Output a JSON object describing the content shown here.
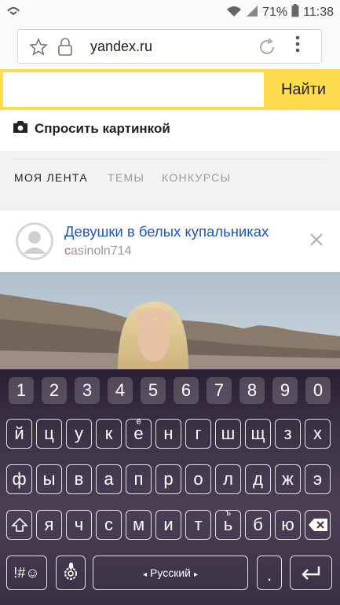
{
  "status_bar": {
    "battery_text": "71%",
    "time": "11:38",
    "icons": [
      "cloud-sync-icon",
      "wifi-icon",
      "signal-icon",
      "battery-icon"
    ]
  },
  "browser": {
    "url": "yandex.ru",
    "icons": [
      "star-icon",
      "lock-icon",
      "reload-icon",
      "more-vert-icon"
    ]
  },
  "search": {
    "value": "",
    "button_label": "Найти",
    "image_search_label": "Спросить картинкой",
    "accent_color": "#ffdb4d"
  },
  "feed_tabs": [
    "МОЯ ЛЕНТА",
    "ТЕМЫ",
    "КОНКУРСЫ"
  ],
  "post": {
    "title": "Девушки в белых купальниках",
    "author_first": "c",
    "author_rest": "asinoln714"
  },
  "keyboard": {
    "numbers": [
      "1",
      "2",
      "3",
      "4",
      "5",
      "6",
      "7",
      "8",
      "9",
      "0"
    ],
    "row1": [
      "й",
      "ц",
      "у",
      "к",
      "е",
      "н",
      "г",
      "ш",
      "щ",
      "з",
      "х"
    ],
    "row1_hint": "ё",
    "row2": [
      "ф",
      "ы",
      "в",
      "а",
      "п",
      "р",
      "о",
      "л",
      "д",
      "ж",
      "э"
    ],
    "row3": [
      "я",
      "ч",
      "с",
      "м",
      "и",
      "т",
      "ь",
      "б",
      "ю"
    ],
    "row3_hint": "ъ",
    "symbols_label": "!#☺",
    "space_label": "Русский",
    "period_label": "."
  }
}
